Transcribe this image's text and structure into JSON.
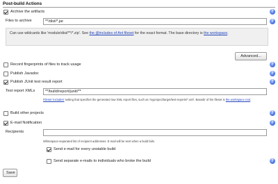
{
  "section": {
    "title": "Post-build Actions"
  },
  "archive": {
    "checkbox_label": "Archive the artifacts",
    "checked": true,
    "files_label": "Files to archive",
    "files_value": "**/dist/*.jar",
    "info_prefix": "Can use wildcards like 'module/dist/**/*.zip'. See ",
    "info_link": "the @includes of Ant fileset",
    "info_middle": " for the exact format. The base directory is ",
    "info_link2": "the workspace",
    "info_suffix": ".",
    "advanced_label": "Advanced..."
  },
  "fingerprints": {
    "label": "Record fingerprints of files to track usage",
    "checked": false
  },
  "javadoc": {
    "label": "Publish Javadoc",
    "checked": false
  },
  "junit": {
    "label": "Publish JUnit test result report",
    "checked": true,
    "xml_label": "Test report XMLs",
    "xml_value": "**/build/report/junit/**",
    "help_link": "Fileset 'includes'",
    "help_middle": " setting that specifies the generated raw XML report files, such as 'myproject/target/test-reports/*.xml'. Basedir of the fileset is ",
    "help_link2": "the workspace root",
    "help_suffix": "."
  },
  "other_projects": {
    "label": "Build other projects",
    "checked": false
  },
  "email": {
    "label": "E-mail Notification",
    "checked": true,
    "recipients_label": "Recipients",
    "recipients_value": "",
    "recipients_help": "Whitespace-separated list of recipient addresses. E-mail will be sent when a build fails.",
    "unstable_label": "Send e-mail for every unstable build",
    "unstable_checked": true,
    "individuals_label": "Send separate e-mails to individuals who broke the build",
    "individuals_checked": false
  },
  "save": {
    "label": "Save"
  },
  "icons": {
    "help": "help-icon",
    "help_glyph": "?"
  }
}
